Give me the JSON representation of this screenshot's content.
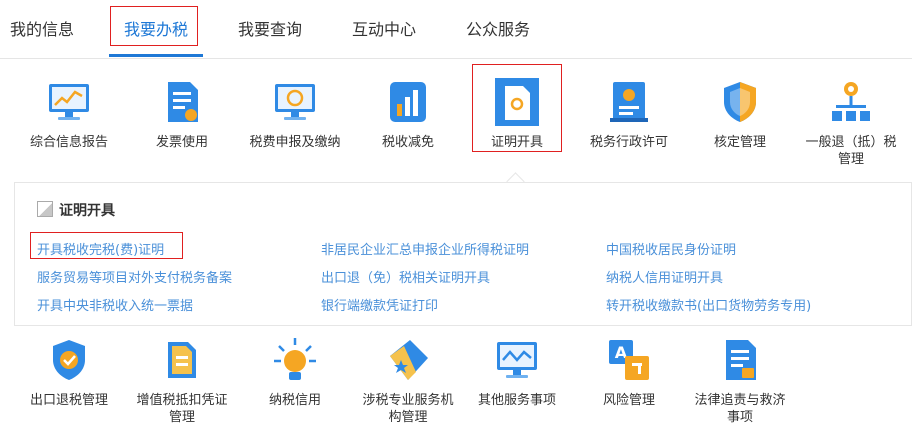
{
  "nav": {
    "tabs": [
      "我的信息",
      "我要办税",
      "我要查询",
      "互动中心",
      "公众服务"
    ],
    "active_index": 1
  },
  "grid_top": [
    {
      "label": "综合信息报告",
      "icon": "monitor-chart-icon"
    },
    {
      "label": "发票使用",
      "icon": "invoice-document-icon"
    },
    {
      "label": "税费申报及缴纳",
      "icon": "monitor-refresh-icon"
    },
    {
      "label": "税收减免",
      "icon": "bar-chart-icon"
    },
    {
      "label": "证明开具",
      "icon": "certificate-document-icon"
    },
    {
      "label": "税务行政许可",
      "icon": "license-badge-icon"
    },
    {
      "label": "核定管理",
      "icon": "shield-icon"
    },
    {
      "label": "一般退（抵）税管理",
      "icon": "org-tree-icon"
    }
  ],
  "panel": {
    "title": "证明开具",
    "links": [
      "开具税收完税(费)证明",
      "非居民企业汇总申报企业所得税证明",
      "中国税收居民身份证明",
      "服务贸易等项目对外支付税务备案",
      "出口退（免）税相关证明开具",
      "纳税人信用证明开具",
      "开具中央非税收入统一票据",
      "银行端缴款凭证打印",
      "转开税收缴款书(出口货物劳务专用)"
    ]
  },
  "grid_bottom": [
    {
      "label": "出口退税管理",
      "icon": "shield-check-icon"
    },
    {
      "label": "增值税抵扣凭证管理",
      "icon": "voucher-document-icon"
    },
    {
      "label": "纳税信用",
      "icon": "lightbulb-badge-icon"
    },
    {
      "label": "涉税专业服务机构管理",
      "icon": "tag-star-icon"
    },
    {
      "label": "其他服务事项",
      "icon": "monitor-wave-icon"
    },
    {
      "label": "风险管理",
      "icon": "translate-icon"
    },
    {
      "label": "法律追责与救济事项",
      "icon": "legal-document-icon"
    }
  ],
  "colors": {
    "accent": "#1e78d6",
    "highlight_border": "#e02020",
    "link": "#4a90d9"
  }
}
